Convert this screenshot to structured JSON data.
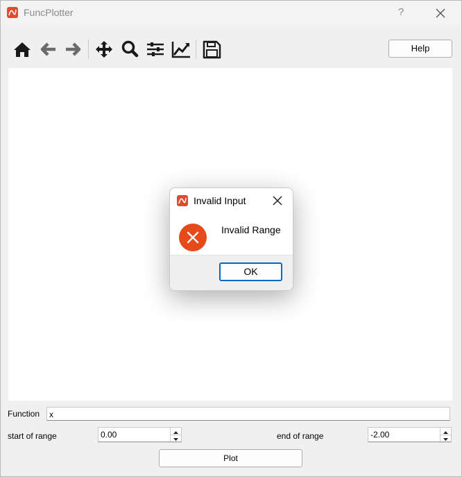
{
  "window": {
    "title": "FuncPlotter",
    "help_glyph": "?"
  },
  "toolbar": {
    "tools": [
      "home-icon",
      "back-arrow-icon",
      "forward-arrow-icon",
      "pan-icon",
      "zoom-icon",
      "subplots-config-icon",
      "edit-axes-icon",
      "save-icon"
    ],
    "help_label": "Help"
  },
  "dialog": {
    "title": "Invalid Input",
    "message": "Invalid Range",
    "ok_label": "OK",
    "icon": "error-icon"
  },
  "form": {
    "function_label": "Function",
    "function_value": "x",
    "start_label": "start of range",
    "start_value": "0.00",
    "end_label": "end of range",
    "end_value": "-2.00",
    "plot_label": "Plot"
  },
  "colors": {
    "accent": "#0067c0",
    "error": "#e64a19",
    "app_icon": "#e04b2e"
  }
}
